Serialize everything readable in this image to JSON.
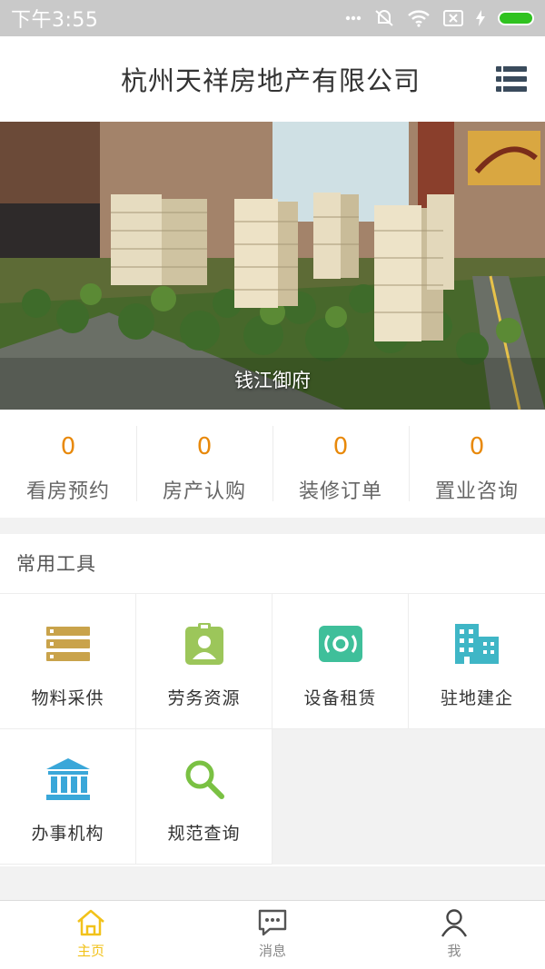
{
  "status_bar": {
    "time": "下午3:55"
  },
  "header": {
    "title": "杭州天祥房地产有限公司"
  },
  "banner": {
    "caption": "钱江御府"
  },
  "stats": [
    {
      "value": "0",
      "label": "看房预约"
    },
    {
      "value": "0",
      "label": "房产认购"
    },
    {
      "value": "0",
      "label": "装修订单"
    },
    {
      "value": "0",
      "label": "置业咨询"
    }
  ],
  "tools": {
    "title": "常用工具",
    "items": [
      {
        "label": "物料采供",
        "icon": "stack-icon",
        "color": "#c9a34b"
      },
      {
        "label": "劳务资源",
        "icon": "badge-icon",
        "color": "#9cc65a"
      },
      {
        "label": "设备租赁",
        "icon": "device-icon",
        "color": "#3fbf9a"
      },
      {
        "label": "驻地建企",
        "icon": "building-icon",
        "color": "#3fb6c6"
      },
      {
        "label": "办事机构",
        "icon": "institution-icon",
        "color": "#3aa7d9"
      },
      {
        "label": "规范查询",
        "icon": "search-icon",
        "color": "#7ac143"
      }
    ]
  },
  "bottom_nav": [
    {
      "label": "主页",
      "icon": "home-icon",
      "active": true
    },
    {
      "label": "消息",
      "icon": "message-icon",
      "active": false
    },
    {
      "label": "我",
      "icon": "user-icon",
      "active": false
    }
  ],
  "colors": {
    "accent": "#f2c21a",
    "stat_value": "#e8890b",
    "menu_icon": "#3a4b5c"
  }
}
